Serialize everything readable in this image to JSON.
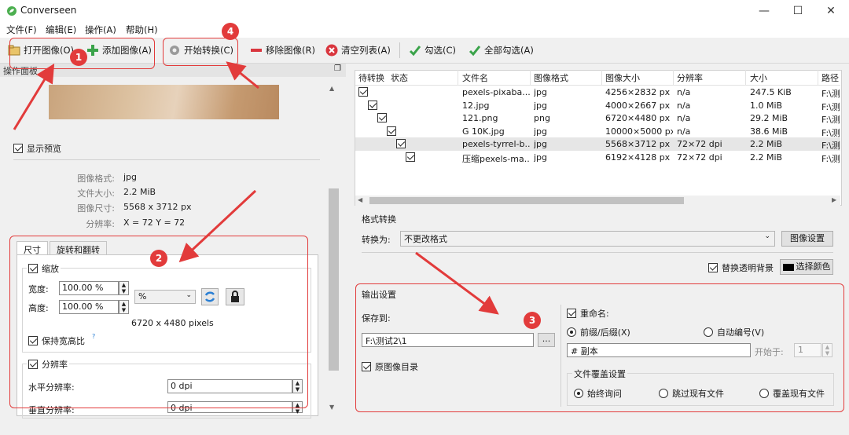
{
  "app": {
    "title": "Converseen",
    "icon": "converseen-leaf-icon"
  },
  "window_controls": {
    "minimize": "—",
    "maximize": "☐",
    "close": "✕"
  },
  "menu": [
    "文件(F)",
    "编辑(E)",
    "操作(A)",
    "帮助(H)"
  ],
  "toolbar": {
    "open": "打开图像(O)",
    "add": "添加图像(A)",
    "convert": "开始转换(C)",
    "remove": "移除图像(R)",
    "clear": "清空列表(A)",
    "check": "勾选(C)",
    "check_all": "全部勾选(A)"
  },
  "panel": {
    "title": "操作面板",
    "show_preview": "显示预览",
    "info": [
      {
        "label": "图像格式:",
        "value": "jpg"
      },
      {
        "label": "文件大小:",
        "value": "2.2 MiB"
      },
      {
        "label": "图像尺寸:",
        "value": "5568 x 3712 px"
      },
      {
        "label": "分辨率:",
        "value": "X = 72 Y = 72"
      }
    ],
    "tabs": [
      "尺寸",
      "旋转和翻转"
    ],
    "scale": {
      "label": "缩放",
      "width_label": "宽度:",
      "width_value": "100.00 %",
      "height_label": "高度:",
      "height_value": "100.00 %",
      "unit": "%",
      "pixels": "6720 x 4480 pixels",
      "keep_ratio": "保持宽高比",
      "help": "?"
    },
    "resolution": {
      "label": "分辨率",
      "horizontal_label": "水平分辨率:",
      "horizontal_value": "0 dpi",
      "vertical_label": "垂直分辨率:",
      "vertical_value": "0 dpi"
    }
  },
  "table": {
    "columns": [
      "待转换",
      "状态",
      "文件名",
      "图像格式",
      "图像大小",
      "分辨率",
      "大小",
      "路径"
    ],
    "rows": [
      {
        "name": "pexels-pixaba...",
        "format": "jpg",
        "size": "4256×2832 px",
        "res": "n/a",
        "filesize": "247.5 KiB",
        "path": "F:\\测"
      },
      {
        "name": "12.jpg",
        "format": "jpg",
        "size": "4000×2667 px",
        "res": "n/a",
        "filesize": "1.0 MiB",
        "path": "F:\\测"
      },
      {
        "name": "121.png",
        "format": "png",
        "size": "6720×4480 px",
        "res": "n/a",
        "filesize": "29.2 MiB",
        "path": "F:\\测"
      },
      {
        "name": "G 10K.jpg",
        "format": "jpg",
        "size": "10000×5000 px",
        "res": "n/a",
        "filesize": "38.6 MiB",
        "path": "F:\\测"
      },
      {
        "name": "pexels-tyrrel-b...",
        "format": "jpg",
        "size": "5568×3712 px",
        "res": "72×72 dpi",
        "filesize": "2.2 MiB",
        "path": "F:\\测"
      },
      {
        "name": "压缩pexels-ma...",
        "format": "jpg",
        "size": "6192×4128 px",
        "res": "72×72 dpi",
        "filesize": "2.2 MiB",
        "path": "F:\\测"
      }
    ]
  },
  "format": {
    "group": "格式转换",
    "convert_to_label": "转换为:",
    "convert_to_value": "不更改格式",
    "image_settings": "图像设置",
    "replace_bg": "替换透明背景",
    "choose_color": "选择颜色"
  },
  "output": {
    "group": "输出设置",
    "save_to_label": "保存到:",
    "save_to_value": "F:\\测试2\\1",
    "browse": "...",
    "original_dir": "原图像目录",
    "rename": "重命名:",
    "prefix_suffix": "前缀/后缀(X)",
    "auto_number": "自动编号(V)",
    "rename_pattern": "# 副本",
    "start_at_label": "开始于:",
    "start_at_value": "1",
    "overwrite_group": "文件覆盖设置",
    "always_ask": "始终询问",
    "skip_existing": "跳过现有文件",
    "overwrite_existing": "覆盖现有文件"
  },
  "annotations": {
    "b1": "1",
    "b2": "2",
    "b3": "3",
    "b4": "4"
  },
  "colors": {
    "annotation_red": "#e23b3b",
    "accent_green": "#3aa34a"
  }
}
